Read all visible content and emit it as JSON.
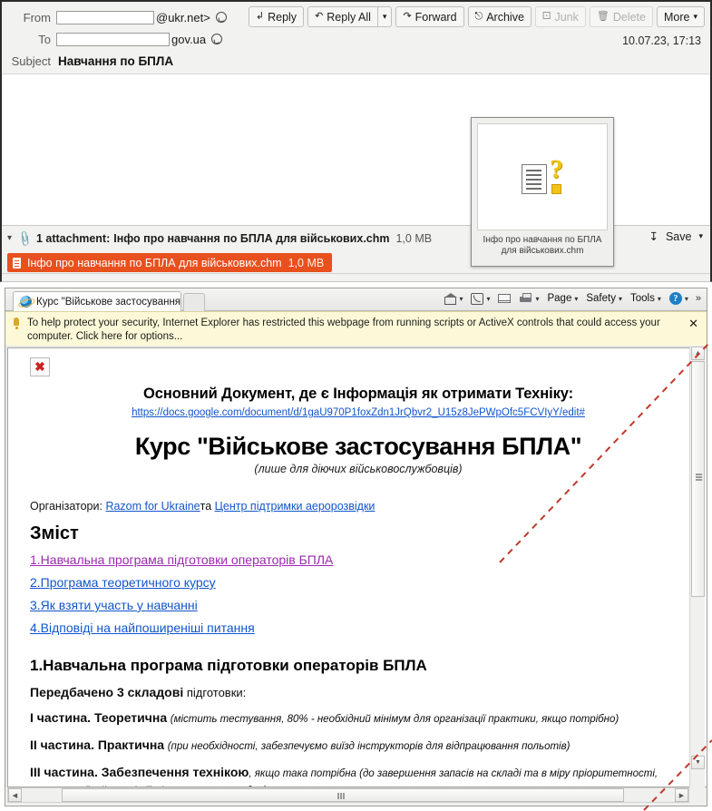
{
  "mail": {
    "fields": {
      "from_label": "From",
      "from_value": "@ukr.net>",
      "to_label": "To",
      "to_value": "gov.ua",
      "subject_label": "Subject",
      "subject_value": "Навчання по БПЛА"
    },
    "date": "10.07.23, 17:13",
    "toolbar": {
      "reply": "Reply",
      "reply_all": "Reply All",
      "forward": "Forward",
      "archive": "Archive",
      "junk": "Junk",
      "delete": "Delete",
      "more": "More"
    },
    "attachment": {
      "summary": "1 attachment:",
      "filename": "Інфо про навчання по БПЛА для військових.chm",
      "size": "1,0 MB",
      "save_label": "Save",
      "chip_filename": "Інфо про навчання по БПЛА для військових.chm",
      "chip_size": "1,0 MB"
    },
    "thumbnail": {
      "caption_line1": "Інфо про навчання по БПЛА",
      "caption_line2": "для військових.chm"
    }
  },
  "browser": {
    "tab_title": "Курс \"Військове застосування...",
    "commands": {
      "page": "Page",
      "safety": "Safety",
      "tools": "Tools",
      "help": "?",
      "overflow": "»"
    },
    "infobar": {
      "text": "To help protect your security, Internet Explorer has restricted this webpage from running scripts or ActiveX controls that could access your computer. Click here for options...",
      "close": "✕"
    },
    "broken_image_glyph": "✖"
  },
  "document": {
    "top_title": "Основний Документ, де є Інформація як отримати Техніку:",
    "url": "https://docs.google.com/document/d/1gaU970P1foxZdn1JrQbvr2_U15z8JePWpOfc5FCVIyY/edit#",
    "heading": "Курс \"Військове застосування БПЛА\"",
    "subheading": "(лише для діючих військовослужбовців)",
    "organizers_label": "Організатори:",
    "organizer1": "Razom for Ukraine",
    "organizers_joiner": "та",
    "organizer2": "Центр підтримки аеророзвідки",
    "contents_heading": "Зміст",
    "toc": [
      {
        "text": "1.Навчальна програма підготовки операторів БПЛА",
        "visited": true
      },
      {
        "text": "2.Програма теоретичного курсу",
        "visited": false
      },
      {
        "text": "3.Як взяти участь у навчанні",
        "visited": false
      },
      {
        "text": "4.Відповіді на найпоширеніші питання",
        "visited": false
      }
    ],
    "section1_heading": "1.Навчальна програма підготовки операторів БПЛА",
    "intro_bold": "Передбачено 3 складові",
    "intro_rest": " підготовки:",
    "parts": [
      {
        "bold": "І частина. Теоретична",
        "italic": "(містить тестування, 80% - необхідний мінімум для організації практики, якщо потрібно)"
      },
      {
        "bold": "ІІ частина. Практична",
        "italic": "(при необхідності, забезпечуємо виїзд інструкторів для відпрацювання польотів)"
      },
      {
        "bold": "ІІІ частина. Забезпечення технікою",
        "italic": ", якщо така потрібна (до завершення запасів на складі та в міру пріоритетності, спочатку - \"найгарячіші\" місця виконання задач)"
      }
    ]
  },
  "colors": {
    "attachment_chip": "#e8501e",
    "link": "#1155cc",
    "visited_link": "#9c27b0",
    "annotation": "#c0392b",
    "infobar": "#fdf9d8"
  }
}
